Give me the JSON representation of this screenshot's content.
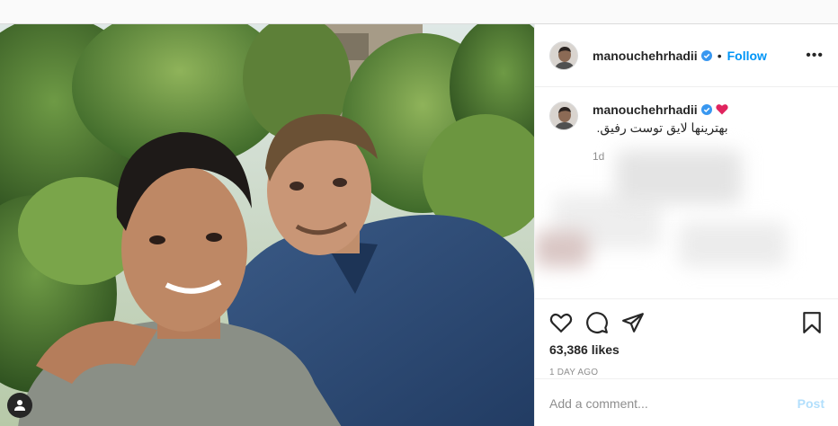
{
  "post": {
    "username": "manouchehrhadii",
    "follow_label": "Follow",
    "separator": "•",
    "more_label": "•••",
    "caption": "بهترینها لایق توست رفیق.",
    "caption_age": "1d",
    "likes": "63,386 likes",
    "date": "1 DAY AGO",
    "comment_placeholder": "Add a comment...",
    "post_label": "Post"
  },
  "icons": {
    "verified": "verified-badge-icon",
    "heart_emoji": "red-heart-emoji",
    "like": "heart-outline-icon",
    "comment": "comment-bubble-icon",
    "share": "paper-plane-icon",
    "save": "bookmark-icon",
    "user_tags": "user-tag-icon",
    "more": "more-options-icon"
  },
  "colors": {
    "accent": "#0095f6",
    "verified": "#3897f0",
    "heart": "#e0245e",
    "muted": "#8e8e8e"
  }
}
